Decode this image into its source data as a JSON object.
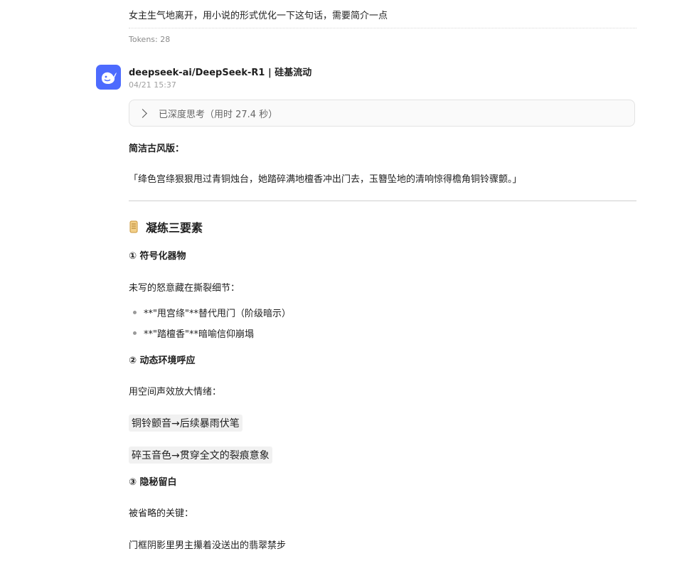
{
  "user_message": {
    "text": "女主生气地离开，用小说的形式优化一下这句话，需要简介一点",
    "tokens": "Tokens: 28"
  },
  "response": {
    "model_name": "deepseek-ai/DeepSeek-R1 | 硅基流动",
    "timestamp": "04/21 15:37",
    "avatar_icon": "deepseek-whale-icon",
    "think_label": "已深度思考（用时 27.4 秒）",
    "section_title": "简洁古风版：",
    "quote": "「绛色宫绦狠狠甩过青铜烛台，她踏碎满地檀香冲出门去，玉簪坠地的清响惊得檐角铜铃骤颤。」",
    "heading": "凝练三要素",
    "heading_icon": "scroll-icon",
    "point1": {
      "title": "① 符号化器物",
      "desc": "未写的怒意藏在撕裂细节：",
      "bullets": [
        "**\"甩宫绦\"**替代甩门（阶级暗示）",
        "**\"踏檀香\"**暗喻信仰崩塌"
      ]
    },
    "point2": {
      "title": "② 动态环境呼应",
      "desc": "用空间声效放大情绪：",
      "chips": [
        "铜铃颤音→后续暴雨伏笔",
        "碎玉音色→贯穿全文的裂痕意象"
      ]
    },
    "point3": {
      "title": "③ 隐秘留白",
      "desc": "被省略的关键：",
      "last": "门框阴影里男主攥着没送出的翡翠禁步"
    }
  },
  "colors": {
    "avatar_bg": "#4d6bfe",
    "think_bg": "#fafafa"
  }
}
